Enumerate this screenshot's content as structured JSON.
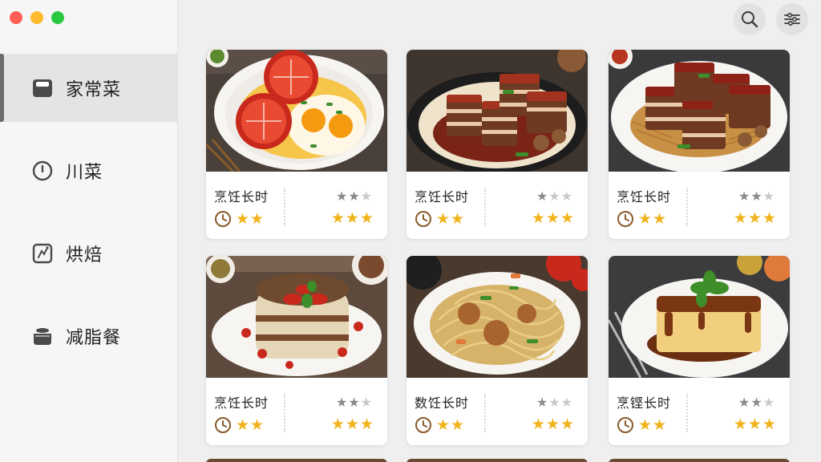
{
  "window": {
    "colors": {
      "close": "#fe5f57",
      "minimize": "#febb2e",
      "maximize": "#28c840"
    }
  },
  "sidebar": {
    "items": [
      {
        "label": "家常菜",
        "icon": "cutting-board-icon",
        "active": true
      },
      {
        "label": "川菜",
        "icon": "clock-icon",
        "active": false
      },
      {
        "label": "烘焙",
        "icon": "recipe-card-icon",
        "active": false
      },
      {
        "label": "减脂餐",
        "icon": "rice-bowl-icon",
        "active": false
      }
    ]
  },
  "toolbar": {
    "search_icon": "search-icon",
    "filter_icon": "filter-icon"
  },
  "cards": [
    {
      "title": "烹饪长时",
      "image": "tomato-and-fried-eggs",
      "difficulty": 2,
      "time_stars": 2,
      "rating": 3
    },
    {
      "title": "烹饪长时",
      "image": "braised-pork-belly",
      "difficulty": 1,
      "time_stars": 2,
      "rating": 3
    },
    {
      "title": "烹饪长时",
      "image": "pork-belly-with-shredded-potato",
      "difficulty": 2,
      "time_stars": 2,
      "rating": 3
    },
    {
      "title": "烹饪长时",
      "image": "layered-cake-with-tomatoes",
      "difficulty": 2,
      "time_stars": 2,
      "rating": 3
    },
    {
      "title": "数饪长时",
      "image": "fried-noodles-with-meatballs",
      "difficulty": 1,
      "time_stars": 2,
      "rating": 3
    },
    {
      "title": "烹铿长时",
      "image": "custard-cake-with-caramel",
      "difficulty": 2,
      "time_stars": 2,
      "rating": 3
    }
  ],
  "colors": {
    "star_gold": "#f1b31c",
    "star_gray": "#8a8a8a",
    "star_light": "#c9c9c9",
    "clock_brown": "#8a5a2b"
  }
}
